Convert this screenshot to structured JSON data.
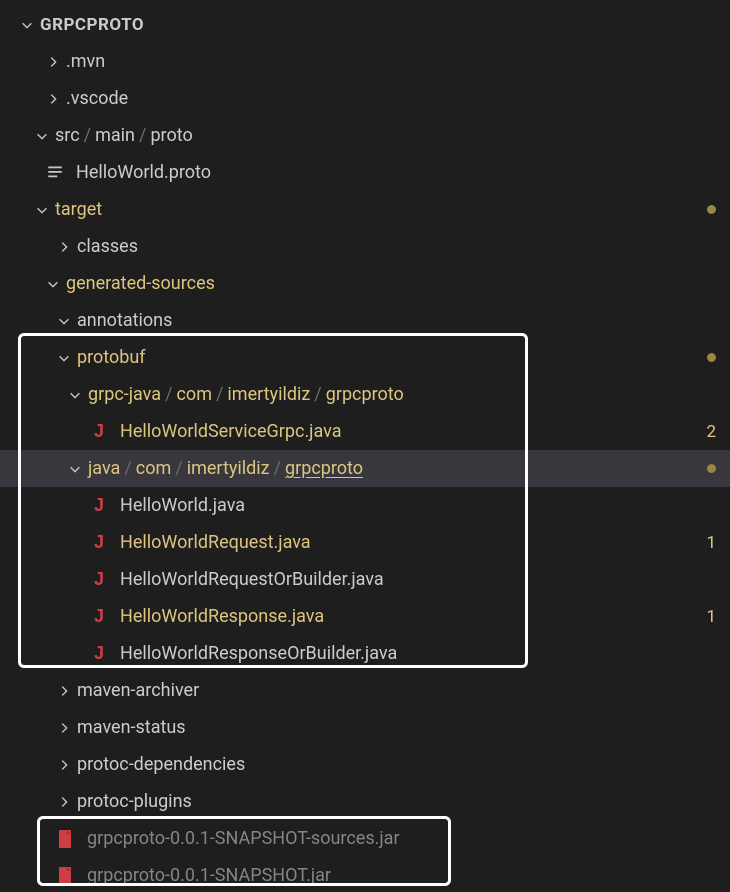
{
  "root": {
    "label": "GRPCPROTO"
  },
  "mvn": {
    "label": ".mvn"
  },
  "vscode": {
    "label": ".vscode"
  },
  "srcPath": {
    "s0": "src",
    "s1": "main",
    "s2": "proto"
  },
  "helloProto": {
    "label": "HelloWorld.proto"
  },
  "target": {
    "label": "target"
  },
  "classes": {
    "label": "classes"
  },
  "gensrc": {
    "label": "generated-sources"
  },
  "annotations": {
    "label": "annotations"
  },
  "protobuf": {
    "label": "protobuf"
  },
  "grpcJavaPath": {
    "s0": "grpc-java",
    "s1": "com",
    "s2": "imertyildiz",
    "s3": "grpcproto"
  },
  "svcGrpc": {
    "label": "HelloWorldServiceGrpc.java",
    "badge": "2"
  },
  "javaPath": {
    "s0": "java",
    "s1": "com",
    "s2": "imertyildiz",
    "s3": "grpcproto"
  },
  "hw": {
    "label": "HelloWorld.java"
  },
  "hwReq": {
    "label": "HelloWorldRequest.java",
    "badge": "1"
  },
  "hwReqOB": {
    "label": "HelloWorldRequestOrBuilder.java"
  },
  "hwResp": {
    "label": "HelloWorldResponse.java",
    "badge": "1"
  },
  "hwRespOB": {
    "label": "HelloWorldResponseOrBuilder.java"
  },
  "mavenArchiver": {
    "label": "maven-archiver"
  },
  "mavenStatus": {
    "label": "maven-status"
  },
  "protocDeps": {
    "label": "protoc-dependencies"
  },
  "protocPlugins": {
    "label": "protoc-plugins"
  },
  "jarSources": {
    "label": "grpcproto-0.0.1-SNAPSHOT-sources.jar"
  },
  "jar": {
    "label": "grpcproto-0.0.1-SNAPSHOT.jar"
  }
}
